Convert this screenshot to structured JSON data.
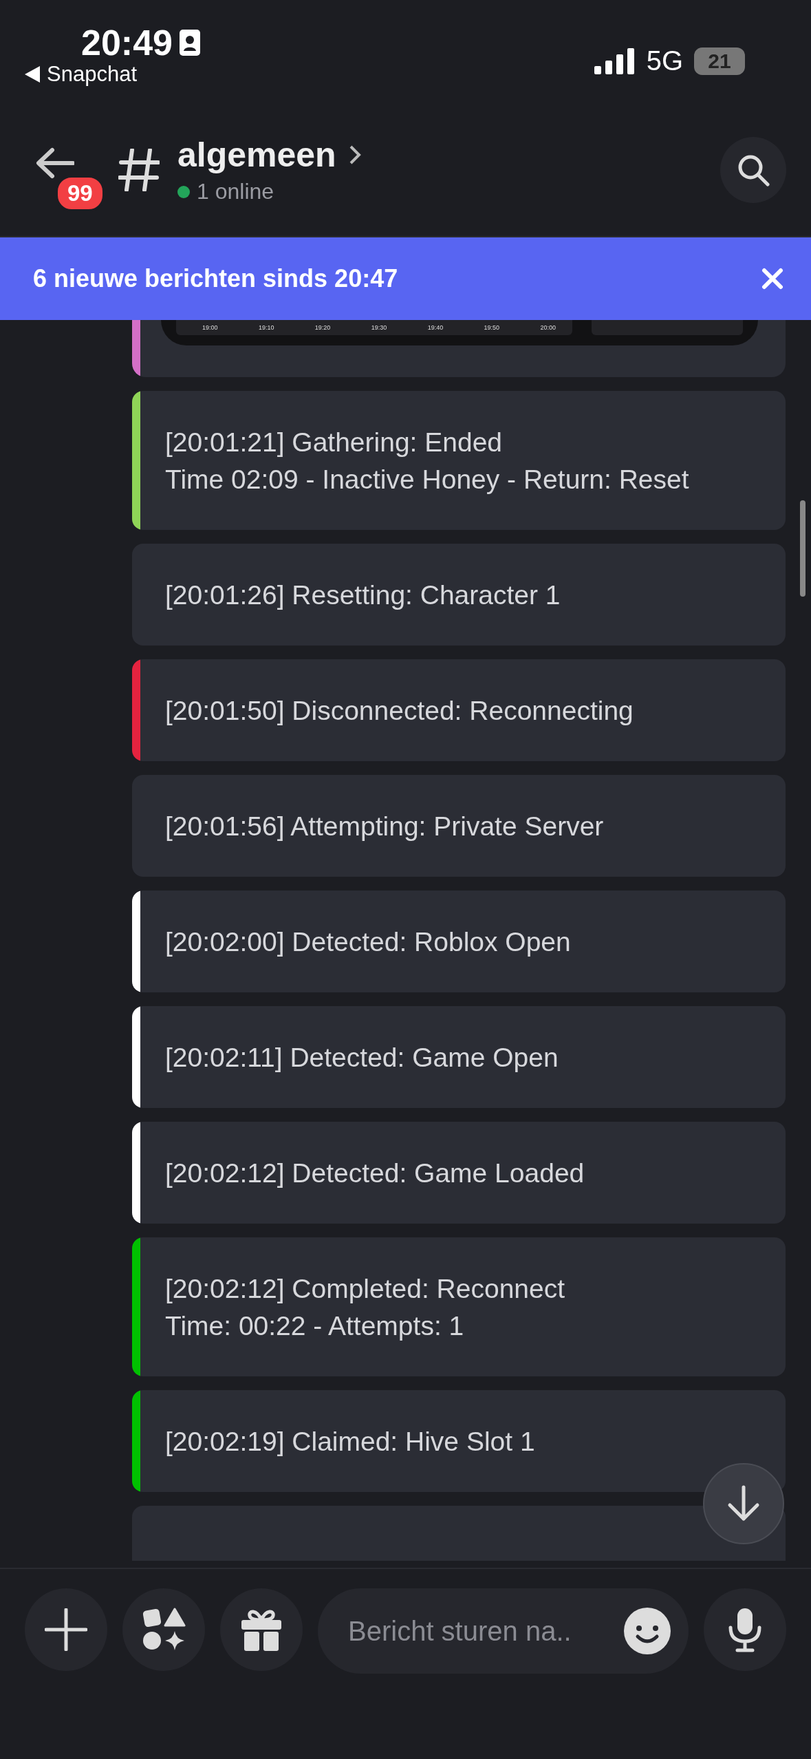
{
  "status_bar": {
    "time": "20:49",
    "back_app": "Snapchat",
    "network": "5G",
    "battery": "21"
  },
  "header": {
    "badge": "99",
    "channel": "algemeen",
    "online": "1 online"
  },
  "banner": {
    "text": "6 nieuwe berichten sinds 20:47"
  },
  "partial_embed": {
    "color": "#d46fc7",
    "image_ticks": [
      "19:00",
      "19:10",
      "19:20",
      "19:30",
      "19:40",
      "19:50",
      "20:00"
    ]
  },
  "embeds": [
    {
      "color": "#8fd457",
      "lines": [
        "[20:01:21] Gathering: Ended",
        "Time 02:09 - Inactive Honey - Return: Reset"
      ]
    },
    {
      "lines": [
        "[20:01:26] Resetting: Character 1"
      ]
    },
    {
      "color": "#e5233f",
      "lines": [
        "[20:01:50] Disconnected: Reconnecting"
      ]
    },
    {
      "lines": [
        "[20:01:56] Attempting: Private Server"
      ]
    },
    {
      "color": "#ffffff",
      "lines": [
        "[20:02:00] Detected: Roblox Open"
      ]
    },
    {
      "color": "#ffffff",
      "lines": [
        "[20:02:11] Detected: Game Open"
      ]
    },
    {
      "color": "#ffffff",
      "lines": [
        "[20:02:12] Detected: Game Loaded"
      ]
    },
    {
      "color": "#00c000",
      "lines": [
        "[20:02:12] Completed: Reconnect",
        "Time: 00:22 - Attempts: 1"
      ]
    },
    {
      "color": "#00c000",
      "lines": [
        "[20:02:19] Claimed: Hive Slot 1"
      ]
    }
  ],
  "composer": {
    "placeholder": "Bericht sturen na.."
  }
}
